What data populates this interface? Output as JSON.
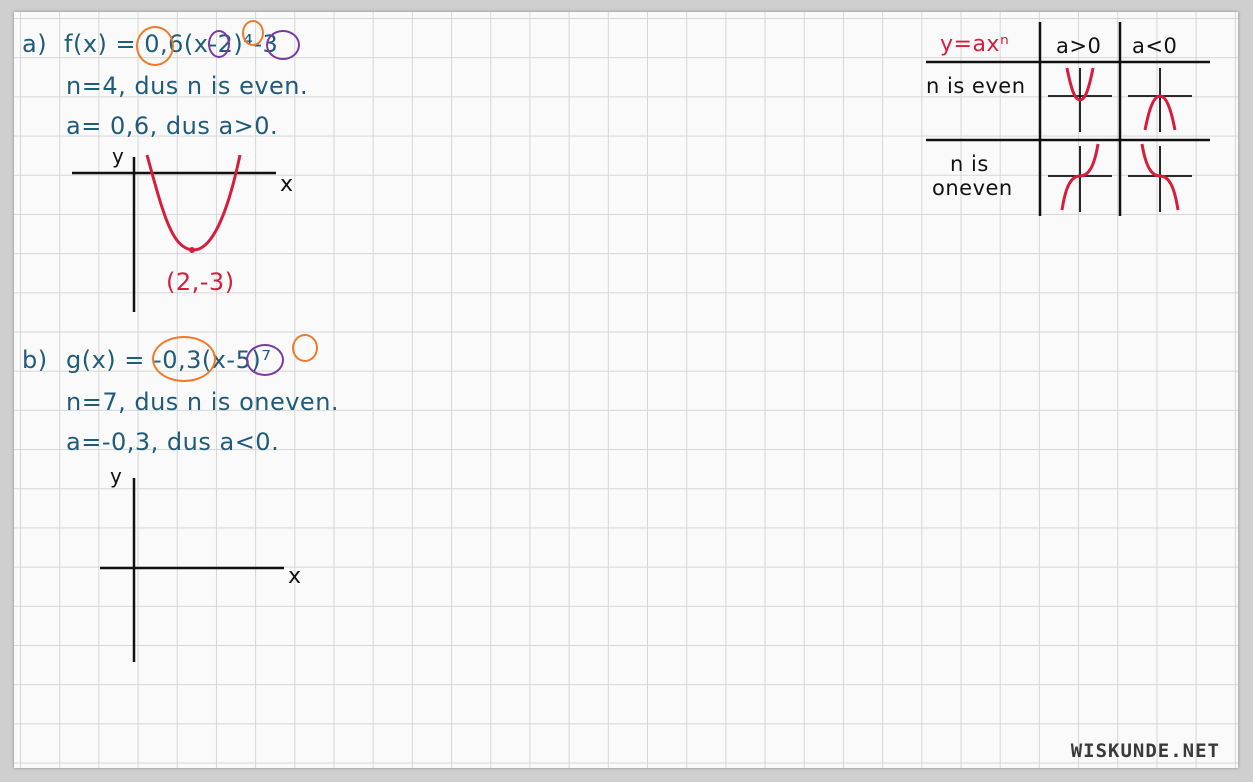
{
  "partA": {
    "label": "a)",
    "formula": "f(x) = 0,6(x-2)⁴-3",
    "line2": "n=4, dus n is even.",
    "line3": "a= 0,6, dus a>0.",
    "axisY": "y",
    "axisX": "x",
    "vertexLabel": "(2,-3)"
  },
  "partB": {
    "label": "b)",
    "formula": "g(x) = -0,3(x-5)⁷",
    "line2": "n=7, dus n is oneven.",
    "line3": "a=-0,3, dus a<0.",
    "axisY": "y",
    "axisX": "x"
  },
  "table": {
    "corner": "y=axⁿ",
    "col1": "a>0",
    "col2": "a<0",
    "row1": "n is even",
    "row2a": "n is",
    "row2b": "oneven"
  },
  "watermark": "WISKUNDE.NET",
  "colors": {
    "ink": "#1f5b7a",
    "red": "#d61e3c",
    "orange": "#f07a2a",
    "purple": "#7a3aa6"
  }
}
